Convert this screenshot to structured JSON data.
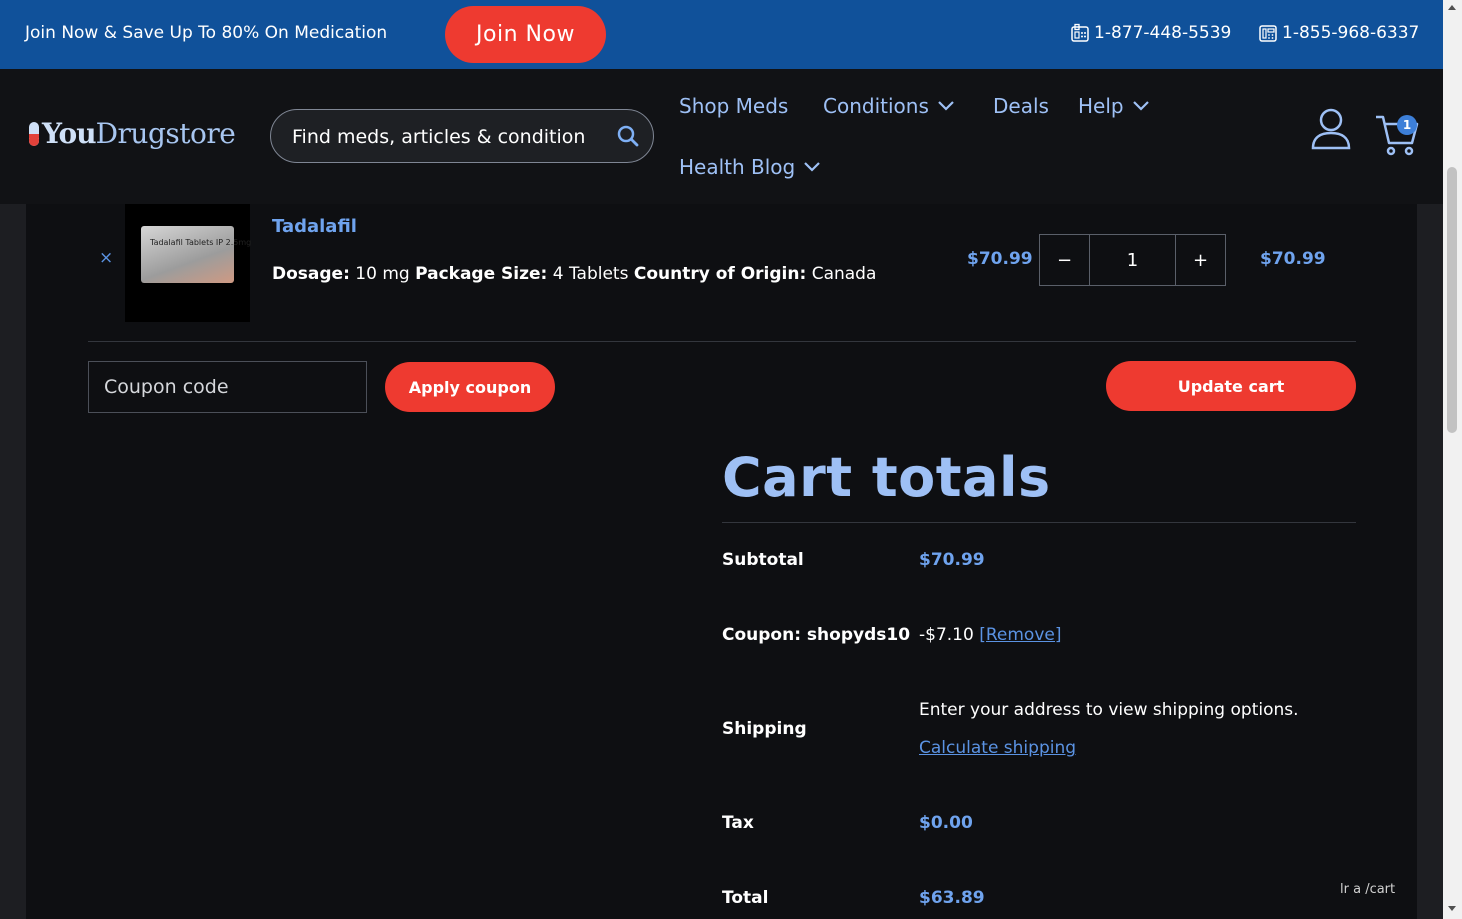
{
  "promo": {
    "text": "Join Now & Save Up To 80% On Medication",
    "join_button": "Join Now",
    "phone1": "1-877-448-5539",
    "phone2": "1-855-968-6337"
  },
  "header": {
    "logo_you": "You",
    "logo_drugstore": "Drugstore",
    "search_placeholder": "Find meds, articles & condition",
    "nav": {
      "shop_meds": "Shop Meds",
      "conditions": "Conditions",
      "deals": "Deals",
      "help": "Help",
      "health_blog": "Health Blog"
    },
    "cart_count": "1"
  },
  "cart_item": {
    "remove": "×",
    "thumb_label": "Tadalafil Tablets IP 2.5mg",
    "name": "Tadalafil",
    "dosage_label": "Dosage:",
    "dosage": "10 mg",
    "package_label": "Package Size:",
    "package": "4 Tablets",
    "origin_label": "Country of Origin:",
    "origin": "Canada",
    "price": "$70.99",
    "qty_minus": "−",
    "quantity": "1",
    "qty_plus": "+",
    "subtotal": "$70.99"
  },
  "actions": {
    "coupon_placeholder": "Coupon code",
    "apply_coupon": "Apply coupon",
    "update_cart": "Update cart"
  },
  "totals": {
    "title": "Cart totals",
    "subtotal_label": "Subtotal",
    "subtotal_value": "$70.99",
    "coupon_label": "Coupon: shopyds10",
    "coupon_value": "-$7.10",
    "coupon_remove": "[Remove]",
    "shipping_label": "Shipping",
    "shipping_text": "Enter your address to view shipping options.",
    "calculate_shipping": "Calculate shipping",
    "tax_label": "Tax",
    "tax_value": "$0.00",
    "total_label": "Total",
    "total_value": "$63.89"
  },
  "status_url": "lr a /cart",
  "colors": {
    "promo_bg": "#10519a",
    "accent_red": "#ee3a30",
    "link_blue": "#6fa3ee",
    "header_bg": "#111215",
    "content_bg": "#0e0f12"
  }
}
